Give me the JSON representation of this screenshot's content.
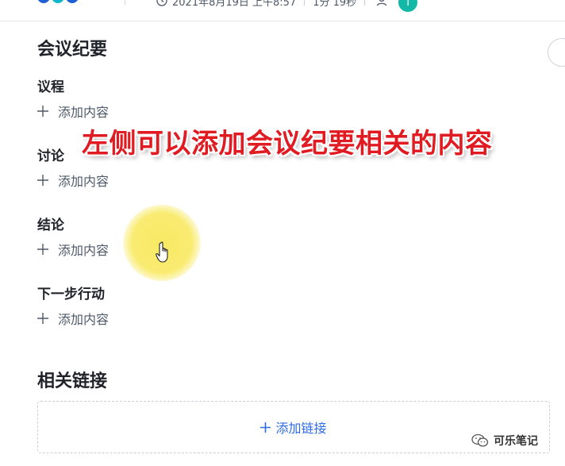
{
  "header": {
    "meeting_time": "2021年8月19日 上午8:57",
    "duration": "1分 19秒",
    "avatar_initial": "T",
    "icons": [
      "clock-icon",
      "person-icon"
    ]
  },
  "minutes": {
    "title": "会议纪要",
    "sections": [
      {
        "label": "议程",
        "add_label": "添加内容"
      },
      {
        "label": "讨论",
        "add_label": "添加内容"
      },
      {
        "label": "结论",
        "add_label": "添加内容"
      },
      {
        "label": "下一步行动",
        "add_label": "添加内容"
      }
    ]
  },
  "related_links": {
    "title": "相关链接",
    "add_link_label": "添加链接"
  },
  "overlay": {
    "caption": "左侧可以添加会议纪要相关的内容"
  },
  "watermark": {
    "text": "可乐笔记"
  },
  "colors": {
    "accent": "#2e6be6",
    "caption": "#e11b22",
    "avatar": "#14b8a6",
    "cursor_highlight": "#f8e85a"
  }
}
